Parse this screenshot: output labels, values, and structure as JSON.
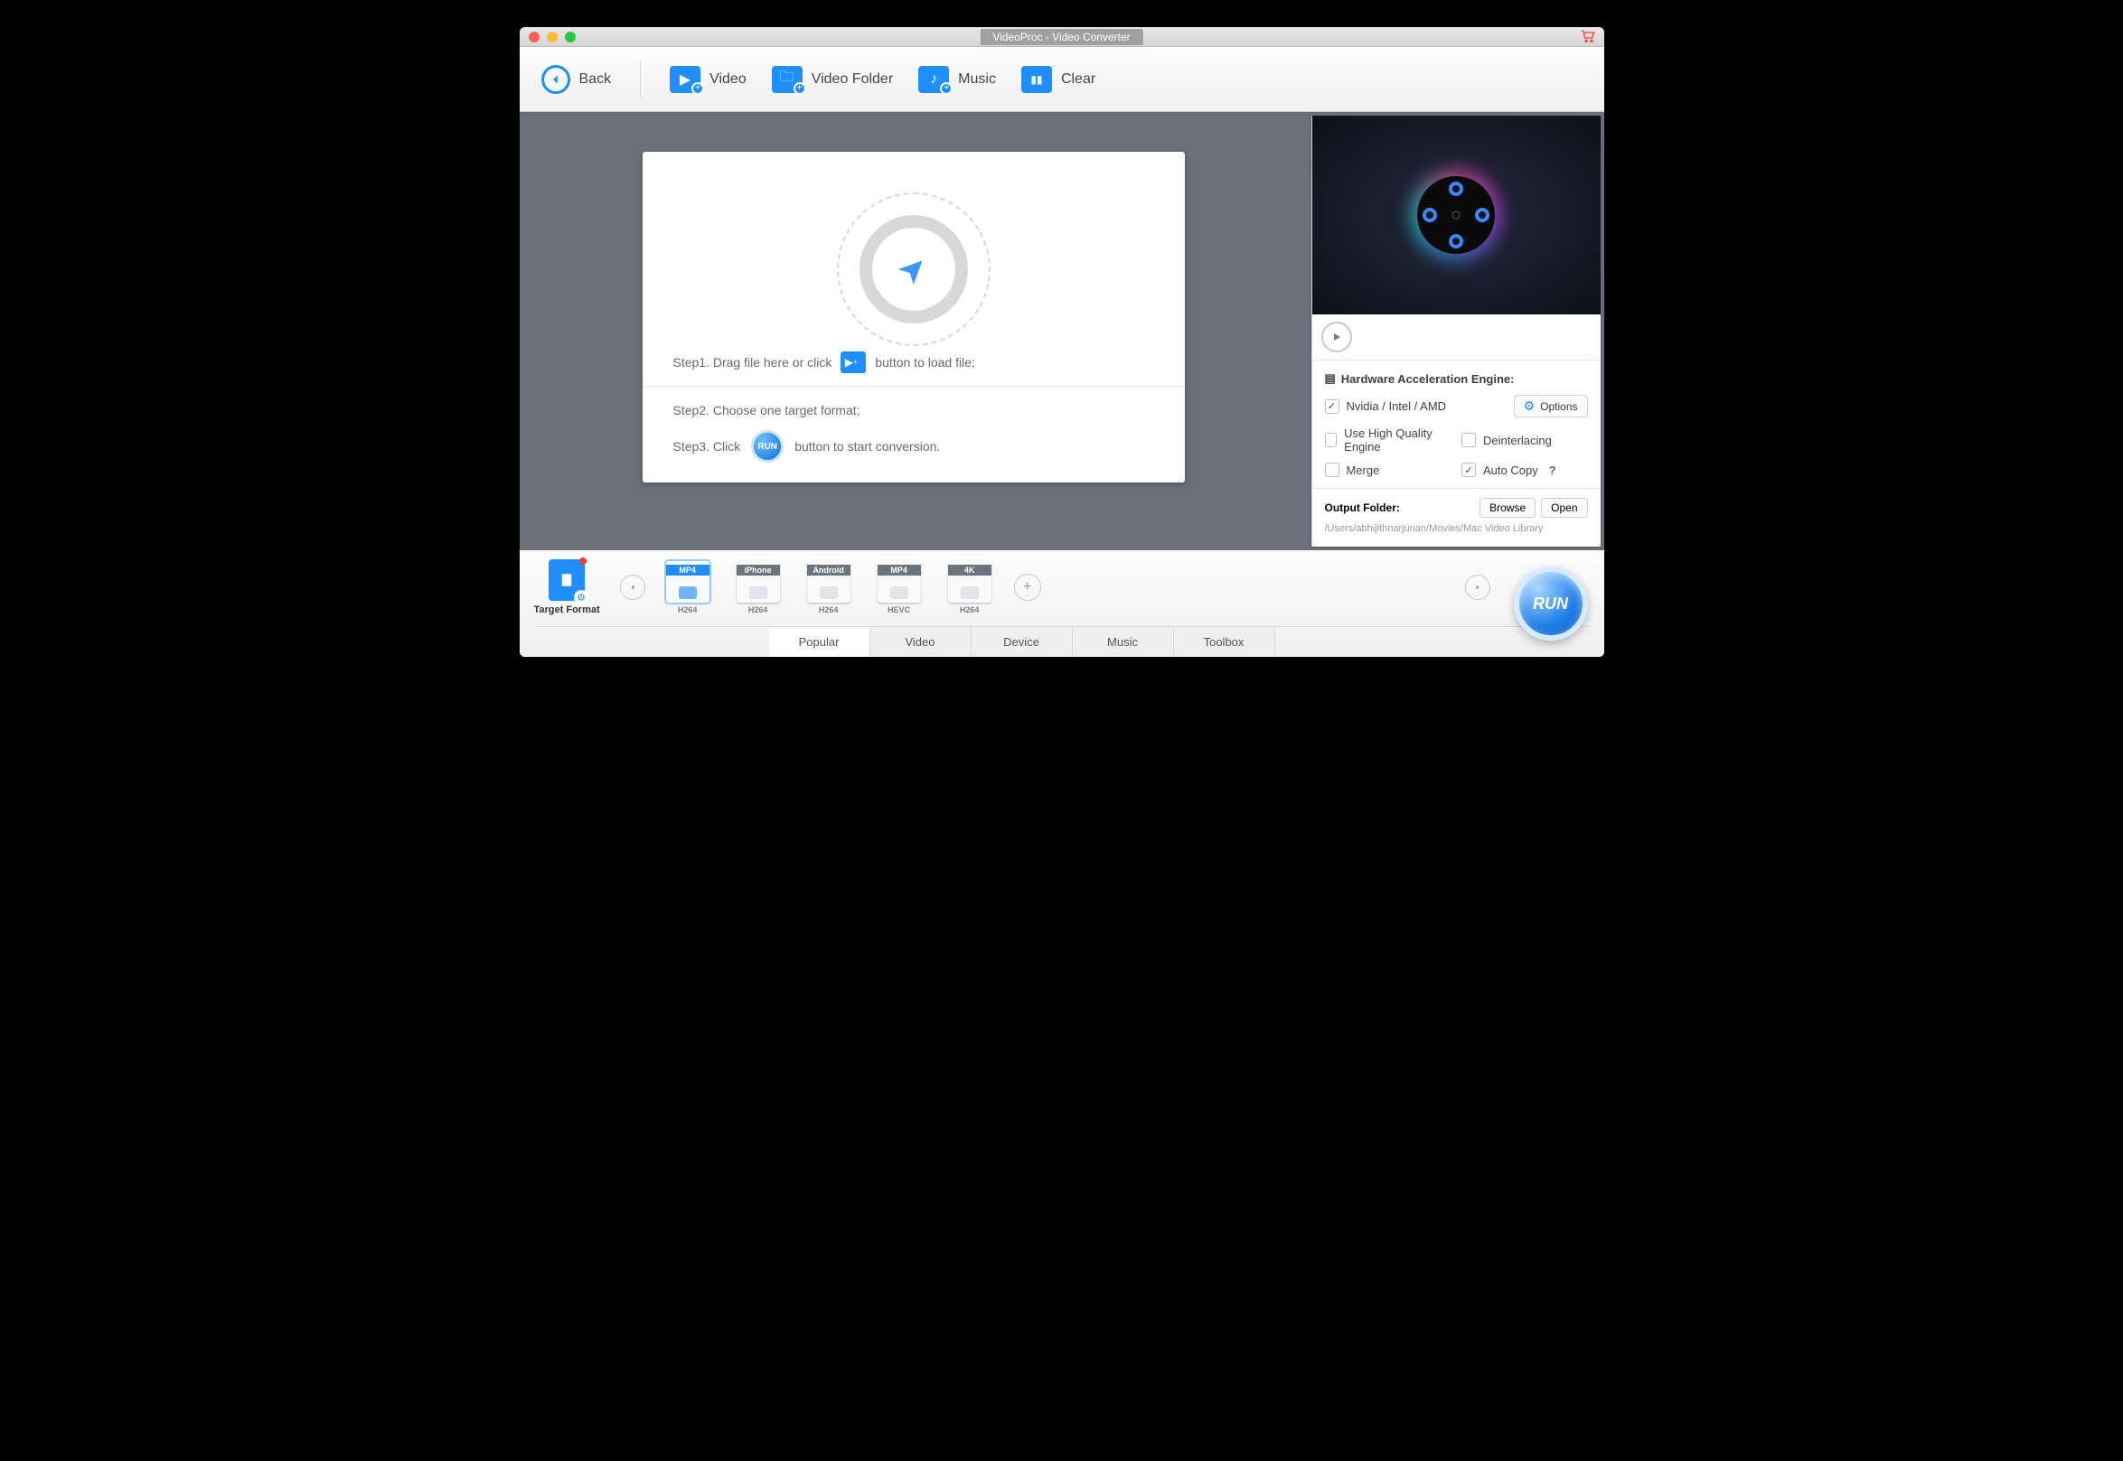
{
  "window": {
    "title": "VideoProc - Video Converter"
  },
  "toolbar": {
    "back": "Back",
    "video": "Video",
    "video_folder": "Video Folder",
    "music": "Music",
    "clear": "Clear"
  },
  "dropzone": {
    "step1_a": "Step1. Drag file here or click",
    "step1_b": "button to load file;",
    "step2": "Step2. Choose one target format;",
    "step3_a": "Step3. Click",
    "step3_b": "button to start conversion.",
    "run_small": "RUN"
  },
  "accel": {
    "title": "Hardware Acceleration Engine:",
    "gpu": "Nvidia / Intel / AMD",
    "options": "Options",
    "hq": "Use High Quality Engine",
    "deint": "Deinterlacing",
    "merge": "Merge",
    "autocopy": "Auto Copy",
    "help": "?"
  },
  "output": {
    "label": "Output Folder:",
    "browse": "Browse",
    "open": "Open",
    "path": "/Users/abhijithnarjunan/Movies/Mac Video Library"
  },
  "target_format_label": "Target Format",
  "formats": [
    {
      "top": "MP4",
      "bot": "H264",
      "sel": true
    },
    {
      "top": "iPhone",
      "bot": "H264"
    },
    {
      "top": "Android",
      "bot": "H264"
    },
    {
      "top": "MP4",
      "bot": "HEVC"
    },
    {
      "top": "4K",
      "bot": "H264"
    }
  ],
  "footer_tabs": {
    "popular": "Popular",
    "video": "Video",
    "device": "Device",
    "music": "Music",
    "toolbox": "Toolbox"
  },
  "run_big": "RUN"
}
